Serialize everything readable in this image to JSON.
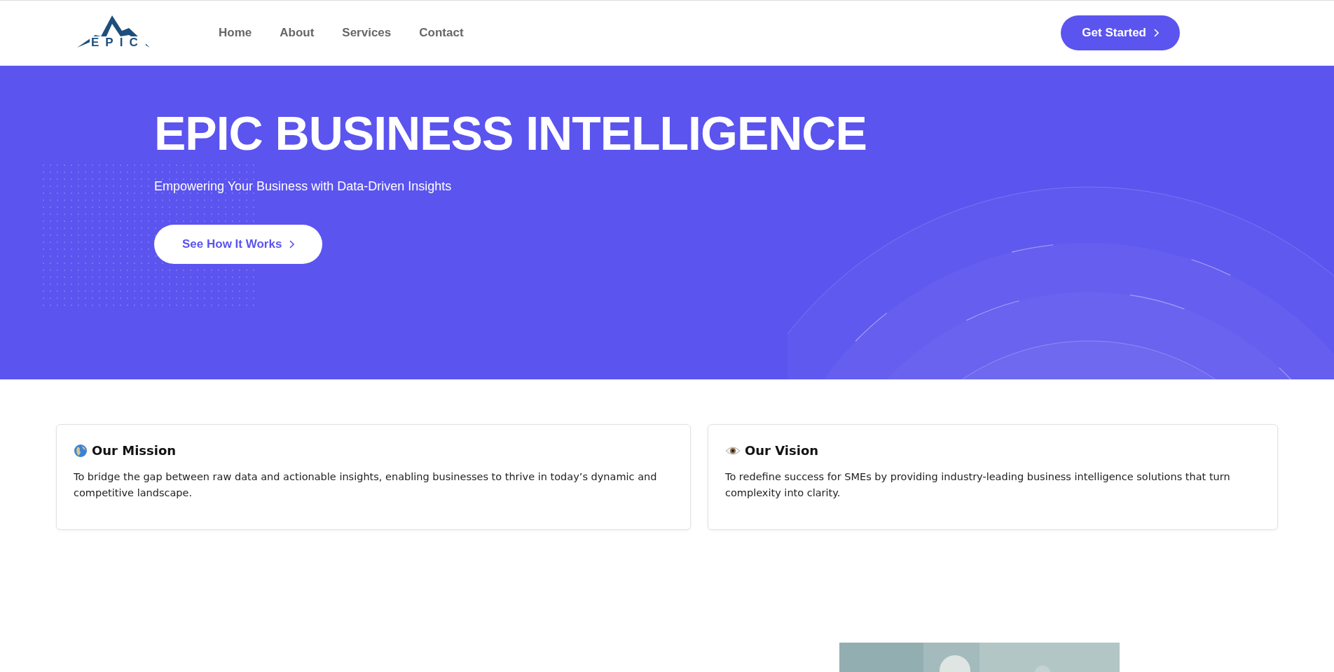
{
  "header": {
    "logo_text": "EPIC",
    "nav": [
      {
        "label": "Home"
      },
      {
        "label": "About"
      },
      {
        "label": "Services"
      },
      {
        "label": "Contact"
      }
    ],
    "cta": "Get Started"
  },
  "hero": {
    "title": "EPIC BUSINESS INTELLIGENCE",
    "subtitle": "Empowering Your Business with Data-Driven Insights",
    "button": "See How It Works"
  },
  "cards": [
    {
      "kind": "globe",
      "title": "Our Mission",
      "text": "To bridge the gap between raw data and actionable insights, enabling businesses to thrive in today’s dynamic and competitive landscape."
    },
    {
      "kind": "eye",
      "title": "Our Vision",
      "text": "To redefine success for SMEs by providing industry-leading business intelligence solutions that turn complexity into clarity."
    }
  ]
}
